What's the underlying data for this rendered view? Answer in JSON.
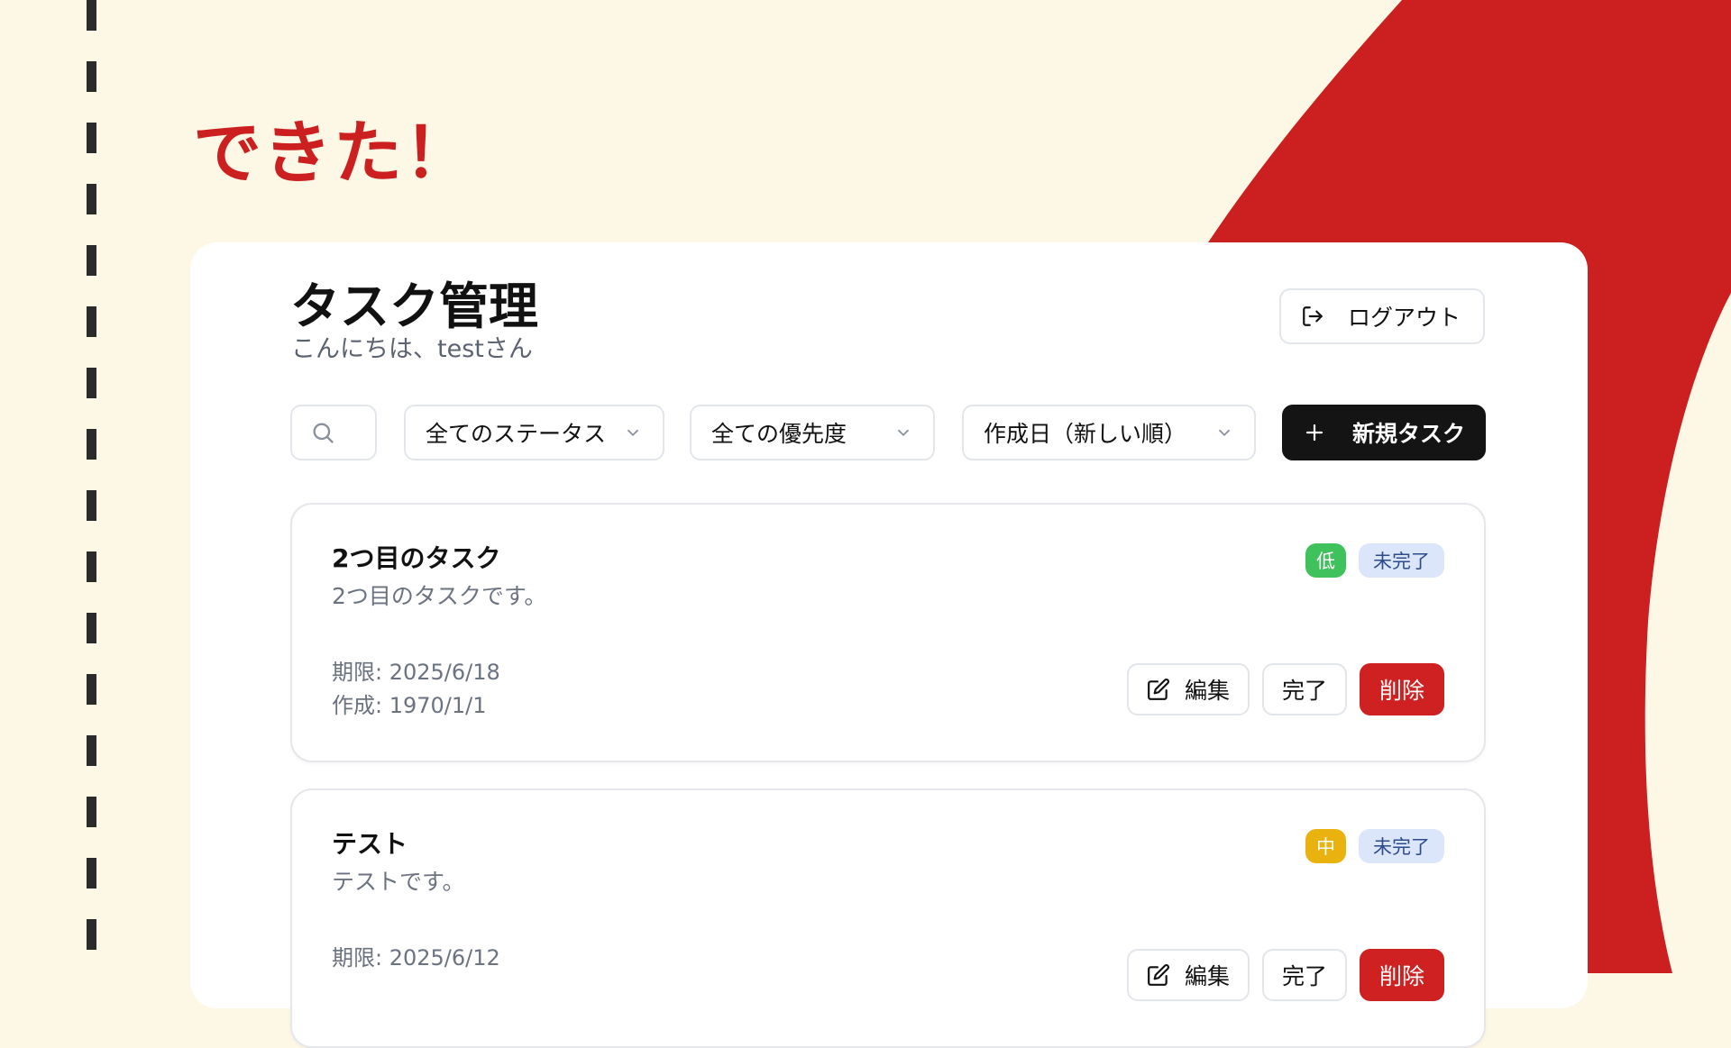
{
  "slide": {
    "heading": "できた！",
    "accent_color": "#cc1f1f",
    "background_color": "#fdf7e6"
  },
  "app": {
    "title": "タスク管理",
    "greeting": "こんにちは、testさん",
    "logout_label": "ログアウト",
    "logout_icon": "logout-icon"
  },
  "toolbar": {
    "search_icon": "search-icon",
    "status_filter": "全てのステータス",
    "priority_filter": "全ての優先度",
    "sort": "作成日（新しい順）",
    "new_task_label": "新規タスク"
  },
  "tasks": [
    {
      "title": "2つ目のタスク",
      "description": "2つ目のタスクです。",
      "due": "期限: 2025/6/18",
      "created": "作成: 1970/1/1",
      "priority": "低",
      "priority_color": "#3fc15b",
      "status": "未完了",
      "edit_label": "編集",
      "complete_label": "完了",
      "delete_label": "削除"
    },
    {
      "title": "テスト",
      "description": "テストです。",
      "due": "期限: 2025/6/12",
      "priority": "中",
      "priority_color": "#e9b20f",
      "status": "未完了",
      "edit_label": "編集",
      "complete_label": "完了",
      "delete_label": "削除"
    }
  ]
}
